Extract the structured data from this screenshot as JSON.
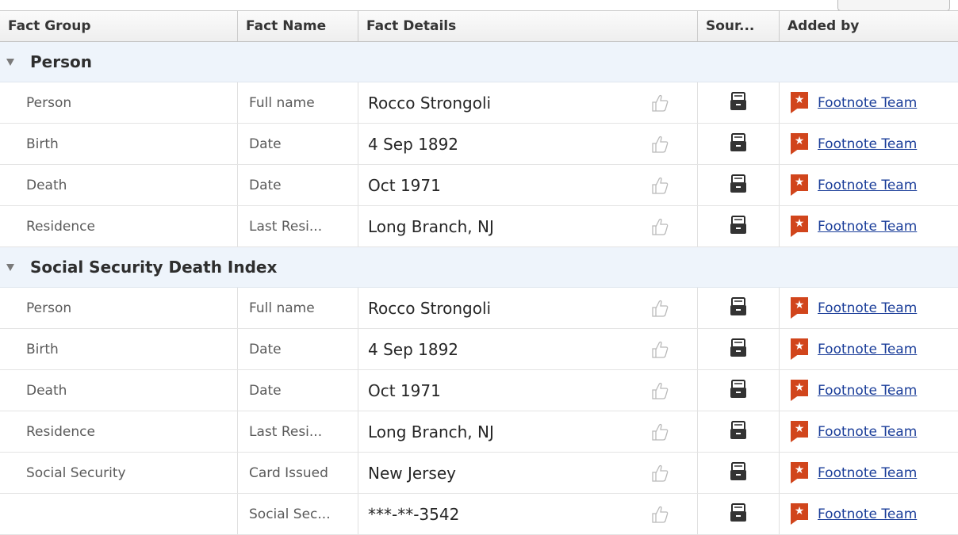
{
  "columns": {
    "fact_group": "Fact Group",
    "fact_name": "Fact Name",
    "fact_details": "Fact Details",
    "source": "Sour...",
    "added_by": "Added by"
  },
  "groups": [
    {
      "title": "Person",
      "rows": [
        {
          "group": "Person",
          "name": "Full name",
          "details": "Rocco Strongoli",
          "added_by": "Footnote Team"
        },
        {
          "group": "Birth",
          "name": "Date",
          "details": "4 Sep 1892",
          "added_by": "Footnote Team"
        },
        {
          "group": "Death",
          "name": "Date",
          "details": "Oct 1971",
          "added_by": "Footnote Team"
        },
        {
          "group": "Residence",
          "name": "Last Resi...",
          "details": "Long Branch, NJ",
          "added_by": "Footnote Team"
        }
      ]
    },
    {
      "title": "Social Security Death Index",
      "rows": [
        {
          "group": "Person",
          "name": "Full name",
          "details": "Rocco Strongoli",
          "added_by": "Footnote Team"
        },
        {
          "group": "Birth",
          "name": "Date",
          "details": "4 Sep 1892",
          "added_by": "Footnote Team"
        },
        {
          "group": "Death",
          "name": "Date",
          "details": "Oct 1971",
          "added_by": "Footnote Team"
        },
        {
          "group": "Residence",
          "name": "Last Resi...",
          "details": "Long Branch, NJ",
          "added_by": "Footnote Team"
        },
        {
          "group": "Social Security",
          "name": "Card Issued",
          "details": "New Jersey",
          "added_by": "Footnote Team"
        },
        {
          "group": "",
          "name": "Social Sec...",
          "details": "***-**-3542",
          "added_by": "Footnote Team"
        }
      ]
    }
  ],
  "icons": {
    "collapse": "collapse-triangle-icon",
    "like": "thumbs-up-icon",
    "source": "source-document-icon",
    "contributor": "contributor-badge-icon"
  },
  "colors": {
    "group_header_bg": "#eef4fb",
    "link": "#1a3d99",
    "badge": "#d1451c"
  }
}
